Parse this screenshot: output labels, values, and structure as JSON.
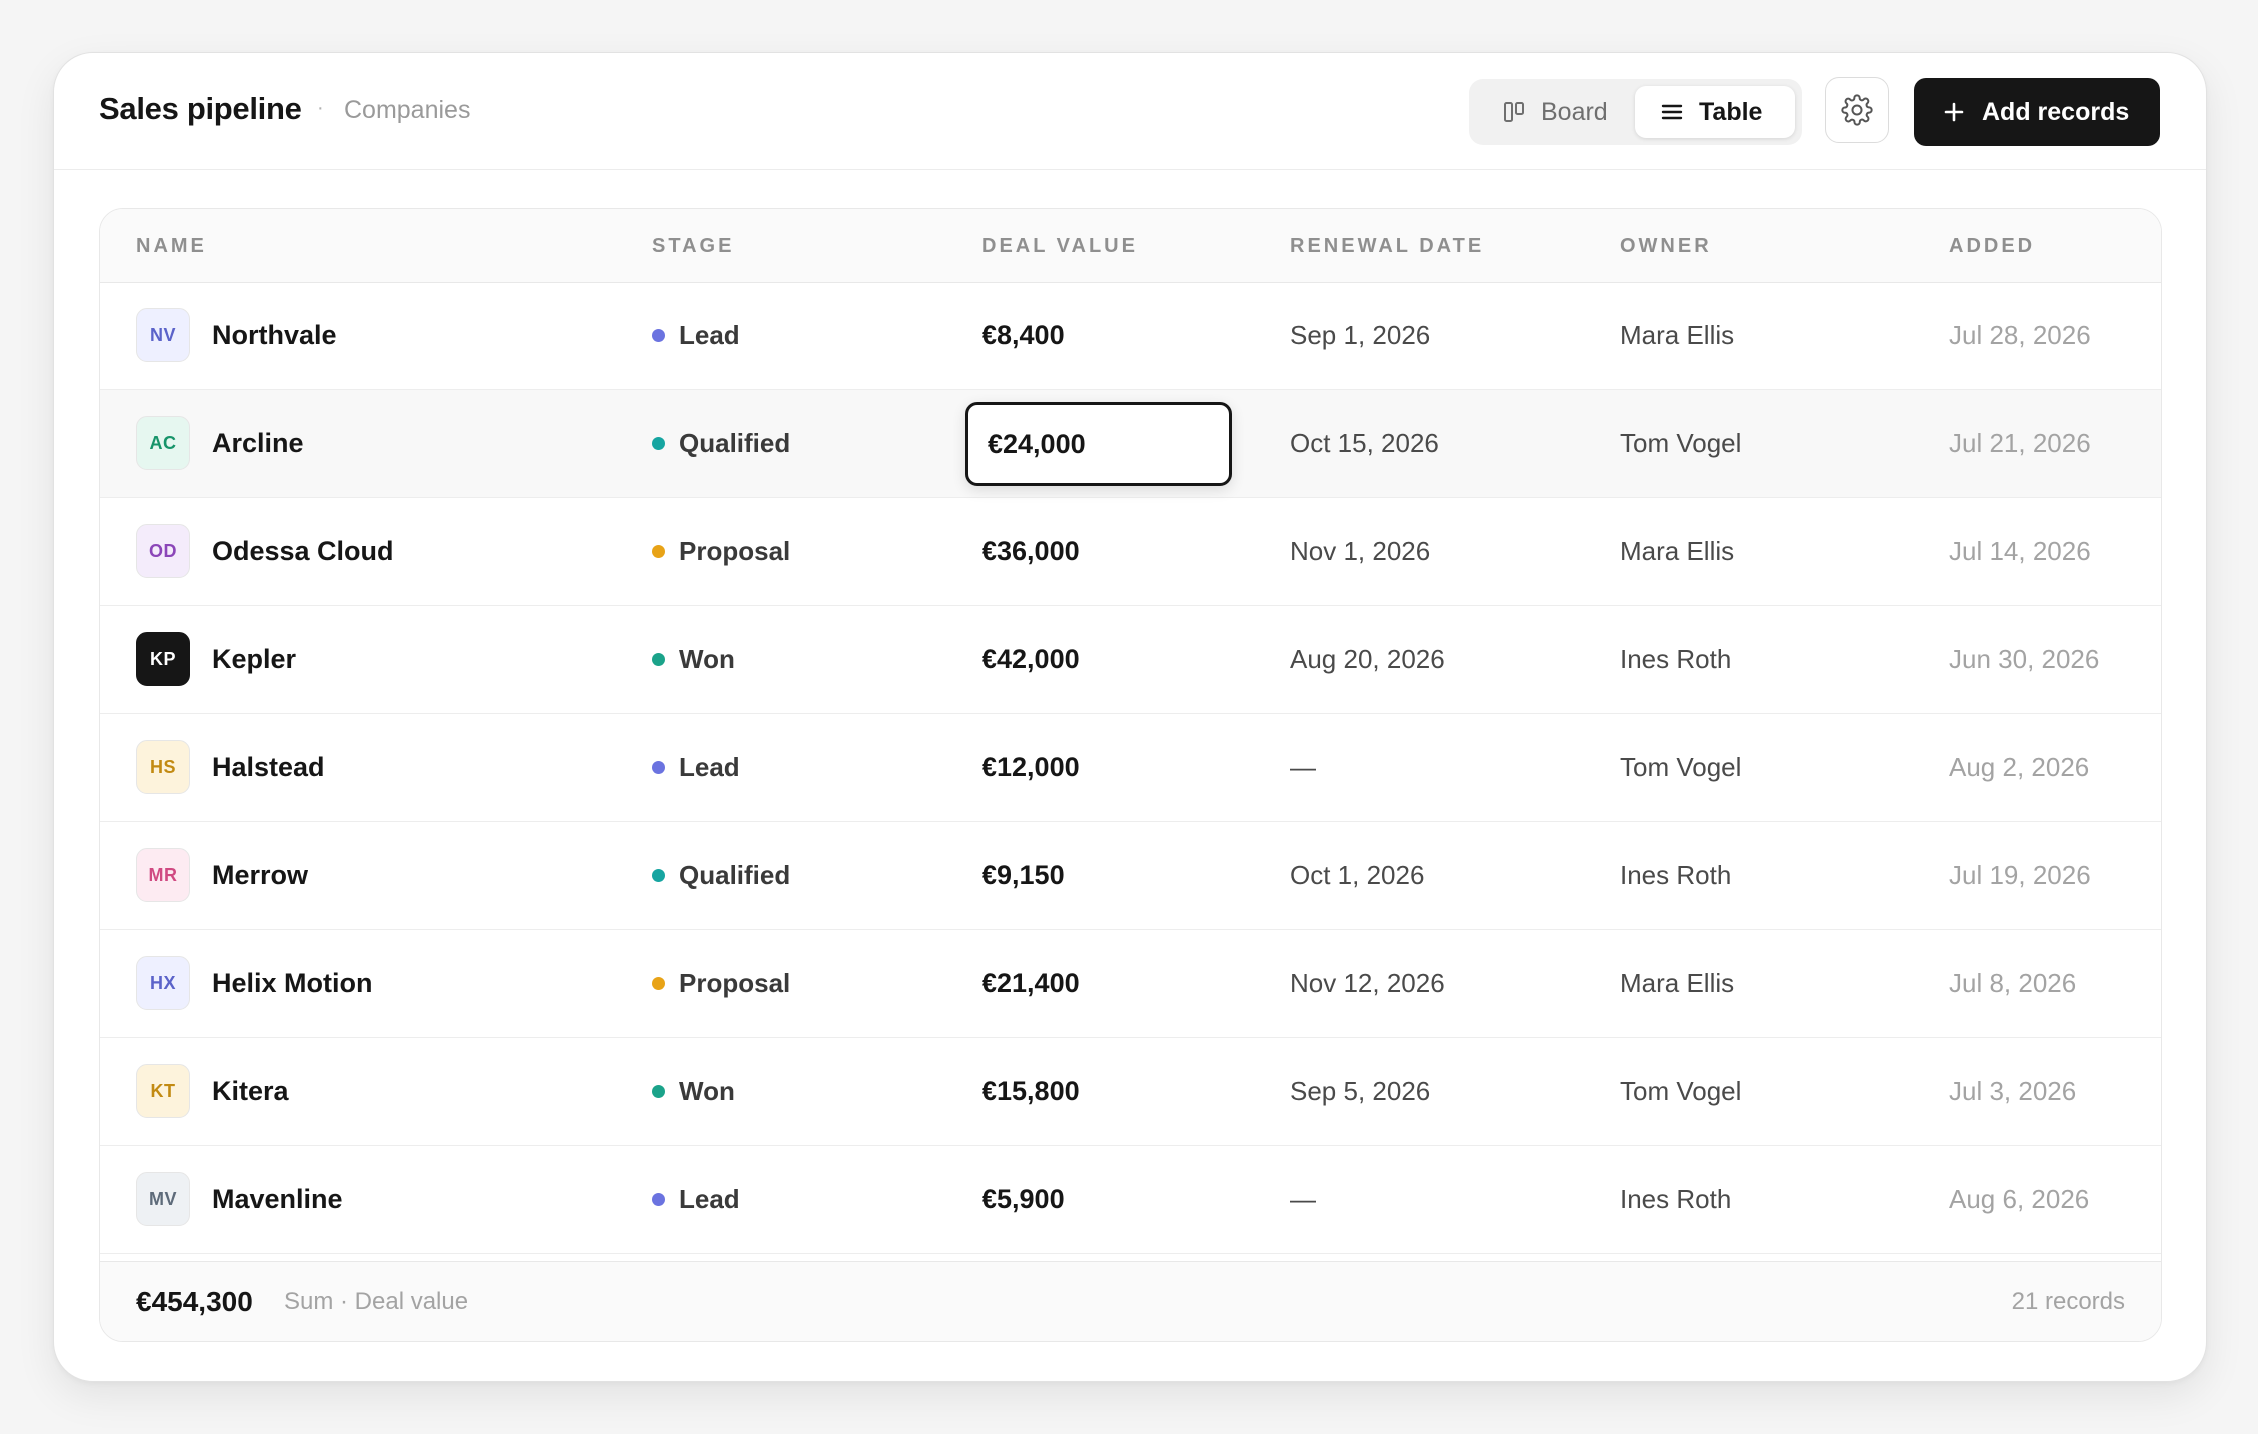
{
  "header": {
    "title": "Sales pipeline",
    "separator": "·",
    "subtitle": "Companies",
    "views": {
      "board_label": "Board",
      "table_label": "Table",
      "active": "Table"
    },
    "settings_icon": "gear-icon",
    "add_label": "Add records"
  },
  "table": {
    "columns": [
      "NAME",
      "STAGE",
      "DEAL VALUE",
      "RENEWAL DATE",
      "OWNER",
      "ADDED"
    ],
    "rows": [
      {
        "initials": "NV",
        "name": "Northvale",
        "stage": "Lead",
        "deal_value": "€8,400",
        "renewal": "Sep 1, 2026",
        "owner": "Mara Ellis",
        "added": "Jul 28, 2026"
      },
      {
        "initials": "AC",
        "name": "Arcline",
        "stage": "Qualified",
        "deal_value": "€24,000",
        "renewal": "Oct 15, 2026",
        "owner": "Tom Vogel",
        "added": "Jul 21, 2026"
      },
      {
        "initials": "OD",
        "name": "Odessa Cloud",
        "stage": "Proposal",
        "deal_value": "€36,000",
        "renewal": "Nov 1, 2026",
        "owner": "Mara Ellis",
        "added": "Jul 14, 2026"
      },
      {
        "initials": "KP",
        "name": "Kepler",
        "stage": "Won",
        "deal_value": "€42,000",
        "renewal": "Aug 20, 2026",
        "owner": "Ines Roth",
        "added": "Jun 30, 2026"
      },
      {
        "initials": "HS",
        "name": "Halstead",
        "stage": "Lead",
        "deal_value": "€12,000",
        "renewal": "—",
        "owner": "Tom Vogel",
        "added": "Aug 2, 2026"
      },
      {
        "initials": "MR",
        "name": "Merrow",
        "stage": "Qualified",
        "deal_value": "€9,150",
        "renewal": "Oct 1, 2026",
        "owner": "Ines Roth",
        "added": "Jul 19, 2026"
      },
      {
        "initials": "HX",
        "name": "Helix Motion",
        "stage": "Proposal",
        "deal_value": "€21,400",
        "renewal": "Nov 12, 2026",
        "owner": "Mara Ellis",
        "added": "Jul 8, 2026"
      },
      {
        "initials": "KT",
        "name": "Kitera",
        "stage": "Won",
        "deal_value": "€15,800",
        "renewal": "Sep 5, 2026",
        "owner": "Tom Vogel",
        "added": "Jul 3, 2026"
      },
      {
        "initials": "MV",
        "name": "Mavenline",
        "stage": "Lead",
        "deal_value": "€5,900",
        "renewal": "—",
        "owner": "Ines Roth",
        "added": "Aug 6, 2026"
      }
    ],
    "editing_row": 1,
    "editing_value": "€24,000"
  },
  "footer": {
    "sum_value": "€454,300",
    "sum_label": "Sum · Deal value",
    "record_count": "21 records"
  },
  "colors": {
    "stage": {
      "Lead": "#6b73e0",
      "Qualified": "#16a5a1",
      "Proposal": "#e8a317",
      "Won": "#1ba38a"
    },
    "avatars": {
      "NV": {
        "bg": "#eef0ff",
        "fg": "#5b63c9"
      },
      "AC": {
        "bg": "#e6f7f0",
        "fg": "#17946a"
      },
      "OD": {
        "bg": "#f4ecfb",
        "fg": "#8b46b8"
      },
      "KP": {
        "bg": "#161616",
        "fg": "#ffffff"
      },
      "HS": {
        "bg": "#fdf3dc",
        "fg": "#c28a12"
      },
      "MR": {
        "bg": "#fdebf2",
        "fg": "#d04a82"
      },
      "HX": {
        "bg": "#eef0ff",
        "fg": "#5b63c9"
      },
      "KT": {
        "bg": "#fdf3dc",
        "fg": "#c28a12"
      },
      "MV": {
        "bg": "#eef1f4",
        "fg": "#5e6b7a"
      }
    },
    "accent": "#161616"
  }
}
